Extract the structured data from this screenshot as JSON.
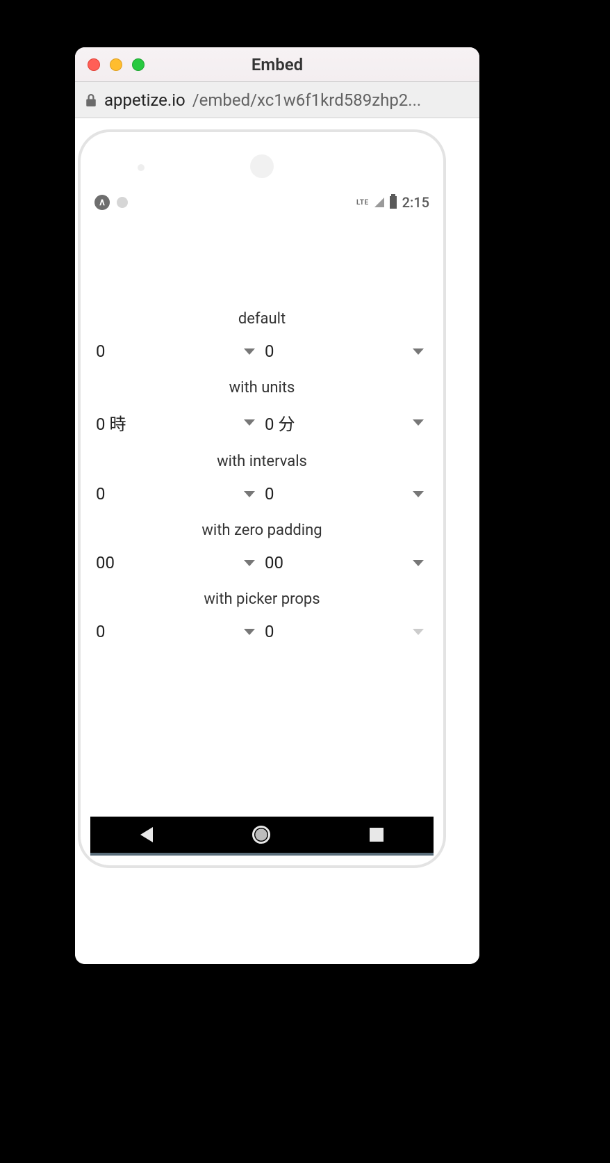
{
  "window": {
    "title": "Embed",
    "url_domain": "appetize.io",
    "url_path": "/embed/xc1w6f1krd589zhp2..."
  },
  "statusbar": {
    "expo_label": "∧",
    "lte": "LTE",
    "time": "2:15"
  },
  "sections": [
    {
      "label": "default",
      "left_value": "0",
      "right_value": "0",
      "right_faded": false
    },
    {
      "label": "with units",
      "left_value": "0 時",
      "right_value": "0 分",
      "right_faded": false
    },
    {
      "label": "with intervals",
      "left_value": "0",
      "right_value": "0",
      "right_faded": false
    },
    {
      "label": "with zero padding",
      "left_value": "00",
      "right_value": "00",
      "right_faded": false
    },
    {
      "label": "with picker props",
      "left_value": "0",
      "right_value": "0",
      "right_faded": true
    }
  ]
}
